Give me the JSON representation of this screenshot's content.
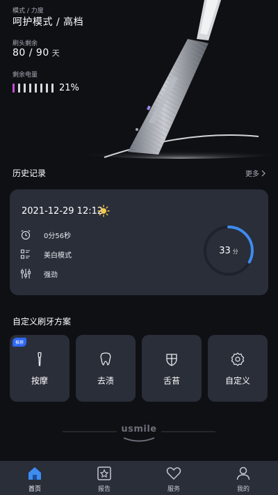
{
  "hero": {
    "mode_label": "模式 / 力度",
    "mode_value": "呵护模式 / 高档",
    "head_label": "刷头剩余",
    "head_value": "80 / 90",
    "head_unit": "天",
    "battery_label": "剩余电量",
    "battery_percent": "21%",
    "battery_fraction": 0.21
  },
  "history": {
    "title": "历史记录",
    "more": "更多",
    "date": "2021-12-29 12:12",
    "duration": "0分56秒",
    "mode": "美白模式",
    "strength": "强劲",
    "score": "33",
    "score_unit": "分",
    "score_fraction": 0.33
  },
  "plans": {
    "title": "自定义刷牙方案",
    "items": [
      {
        "label": "按摩",
        "badge": "推荐",
        "icon": "brush-icon"
      },
      {
        "label": "去渍",
        "icon": "tooth-icon"
      },
      {
        "label": "舌苔",
        "icon": "shield-icon"
      },
      {
        "label": "自定义",
        "icon": "gear-icon"
      }
    ]
  },
  "brand": "usmile",
  "tabs": [
    {
      "label": "首页",
      "icon": "home-icon",
      "active": true
    },
    {
      "label": "报告",
      "icon": "report-icon"
    },
    {
      "label": "服务",
      "icon": "heart-icon"
    },
    {
      "label": "我的",
      "icon": "user-icon"
    }
  ],
  "colors": {
    "background": "#0f1014",
    "card": "#2a2e39",
    "accent_blue": "#3d8cf0",
    "battery_fill": "#c24fd1",
    "sun": "#f5c84a"
  }
}
